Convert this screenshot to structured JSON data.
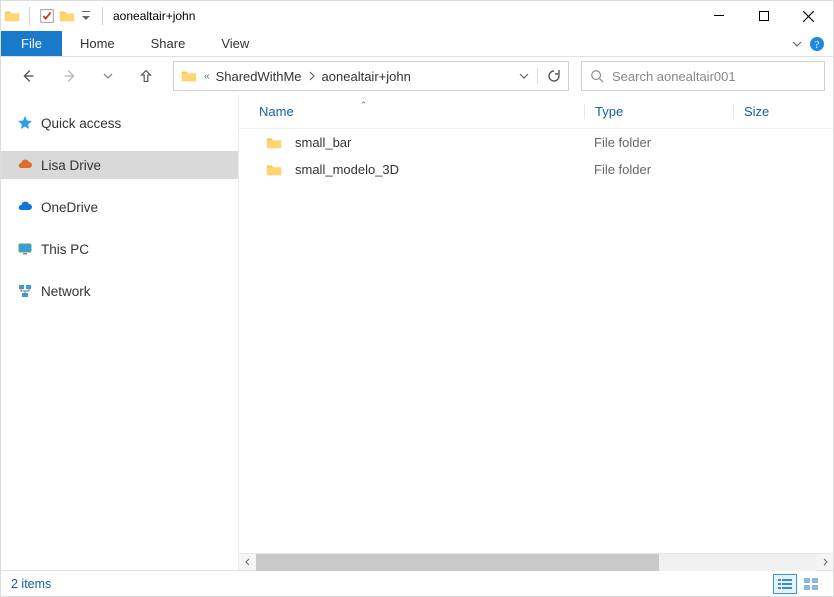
{
  "title": "aonealtair+john",
  "ribbon": {
    "file": "File",
    "tabs": [
      "Home",
      "Share",
      "View"
    ]
  },
  "breadcrumb": [
    "SharedWithMe",
    "aonealtair+john"
  ],
  "search": {
    "placeholder": "Search aonealtair001"
  },
  "sidebar": {
    "items": [
      {
        "label": "Quick access",
        "key": "quick-access"
      },
      {
        "label": "Lisa Drive",
        "key": "lisa-drive",
        "selected": true
      },
      {
        "label": "OneDrive",
        "key": "onedrive"
      },
      {
        "label": "This PC",
        "key": "this-pc"
      },
      {
        "label": "Network",
        "key": "network"
      }
    ]
  },
  "columns": {
    "name": "Name",
    "type": "Type",
    "size": "Size"
  },
  "rows": [
    {
      "name": "small_bar",
      "type": "File folder",
      "size": ""
    },
    {
      "name": "small_modelo_3D",
      "type": "File folder",
      "size": ""
    }
  ],
  "status": {
    "count": "2 items"
  }
}
